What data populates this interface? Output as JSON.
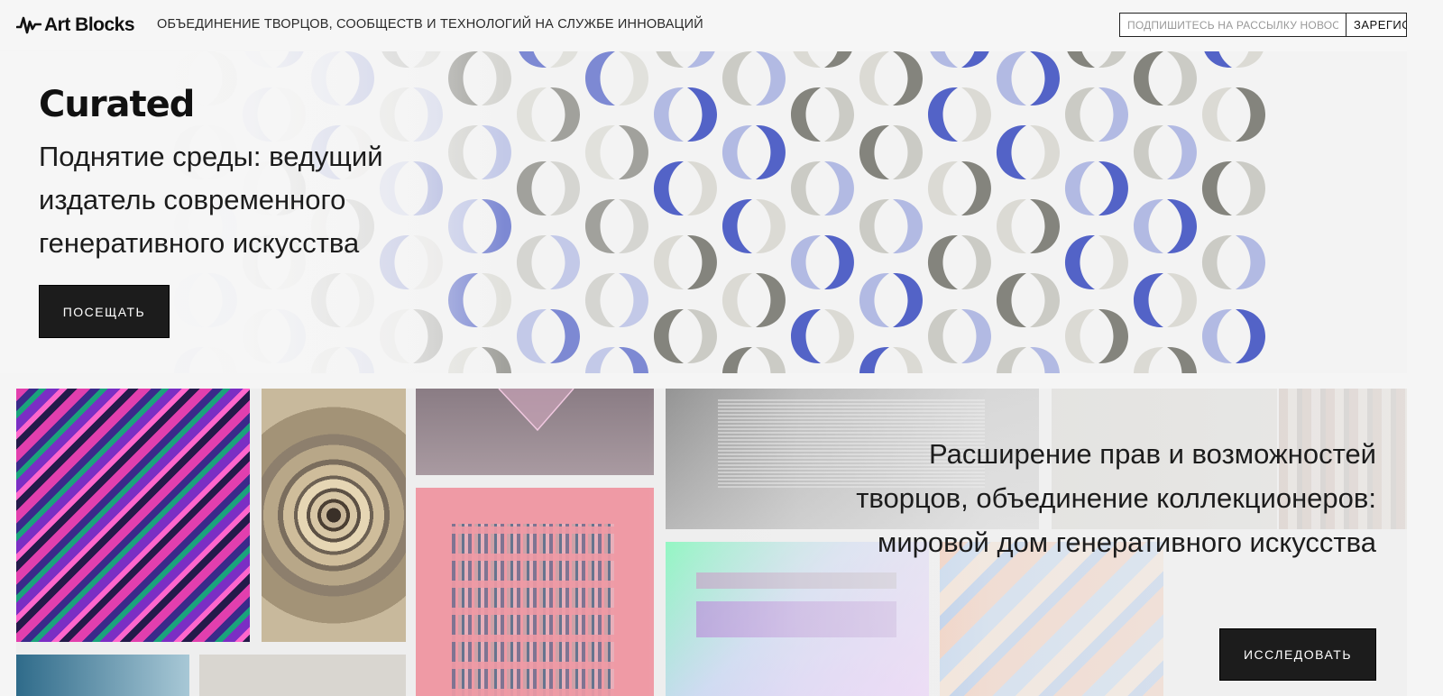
{
  "header": {
    "logo_text": "Art Blocks",
    "tagline": "ОБЪЕДИНЕНИЕ ТВОРЦОВ, СООБЩЕСТВ И ТЕХНОЛОГИЙ НА СЛУЖБЕ ИННОВАЦИЙ",
    "subscribe_placeholder": "ПОДПИШИТЕСЬ НА РАССЫЛКУ НОВОСТЕЙ",
    "subscribe_button": "ЗАРЕГИСТРИРОВАТЬСЯ"
  },
  "hero_curated": {
    "brand": "Curated",
    "title": "Поднятие среды: ведущий издатель современного генеративного искусства",
    "button": "ПОСЕЩАТЬ"
  },
  "hero_main": {
    "title": "Расширение прав и возможностей творцов, объединение коллекционеров: мировой дом генеративного искусства",
    "button": "ИССЛЕДОВАТЬ"
  },
  "colors": {
    "dark_button": "#1c1c1c",
    "pattern_blue": "#4a5bc4",
    "pattern_grey": "#7d7d76",
    "pattern_light": "#d9d8d2"
  }
}
